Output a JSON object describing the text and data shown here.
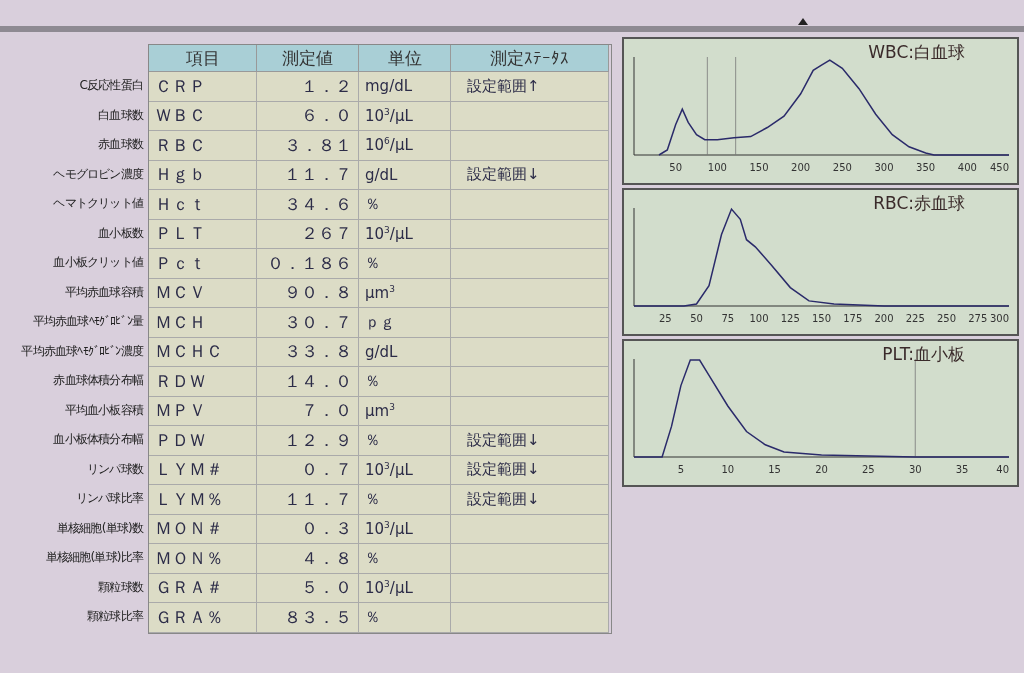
{
  "table": {
    "columns": [
      "項目",
      "測定値",
      "単位",
      "測定ｽﾃｰﾀｽ"
    ],
    "rows": [
      {
        "label": "C反応性蛋白",
        "item": "ＣＲＰ",
        "value": "１．２",
        "unit": "mg/dL",
        "status": "設定範囲↑"
      },
      {
        "label": "白血球数",
        "item": "ＷＢＣ",
        "value": "６．０",
        "unit": "10$^{3}$/μL"
      },
      {
        "label": "赤血球数",
        "item": "ＲＢＣ",
        "value": "３．８１",
        "unit": "10$^{6}$/μL"
      },
      {
        "label": "ヘモグロビン濃度",
        "item": "Ｈｇｂ",
        "value": "１１．７",
        "unit": "g/dL",
        "status": "設定範囲↓"
      },
      {
        "label": "ヘマトクリット値",
        "item": "Ｈｃｔ",
        "value": "３４．６",
        "unit": "％"
      },
      {
        "label": "血小板数",
        "item": "ＰＬＴ",
        "value": "２６７",
        "unit": "10$^{3}$/μL"
      },
      {
        "label": "血小板クリット値",
        "item": "Ｐｃｔ",
        "value": "０．１８６",
        "unit": "％"
      },
      {
        "label": "平均赤血球容積",
        "item": "ＭＣＶ",
        "value": "９０．８",
        "unit": "μm$^{3}$"
      },
      {
        "label": "平均赤血球ﾍﾓｸﾞﾛﾋﾞﾝ量",
        "item": "ＭＣＨ",
        "value": "３０．７",
        "unit": "ｐｇ"
      },
      {
        "label": "平均赤血球ﾍﾓｸﾞﾛﾋﾞﾝ濃度",
        "item": "ＭＣＨＣ",
        "value": "３３．８",
        "unit": "g/dL"
      },
      {
        "label": "赤血球体積分布幅",
        "item": "ＲＤＷ",
        "value": "１４．０",
        "unit": "％"
      },
      {
        "label": "平均血小板容積",
        "item": "ＭＰＶ",
        "value": "７．０",
        "unit": "μm$^{3}$"
      },
      {
        "label": "血小板体積分布幅",
        "item": "ＰＤＷ",
        "value": "１２．９",
        "unit": "％",
        "status": "設定範囲↓"
      },
      {
        "label": "リンパ球数",
        "item": "ＬＹＭ＃",
        "value": "０．７",
        "unit": "10$^{3}$/μL",
        "status": "設定範囲↓"
      },
      {
        "label": "リンパ球比率",
        "item": "ＬＹＭ％",
        "value": "１１．７",
        "unit": "％",
        "status": "設定範囲↓"
      },
      {
        "label": "単核細胞(単球)数",
        "item": "ＭＯＮ＃",
        "value": "０．３",
        "unit": "10$^{3}$/μL"
      },
      {
        "label": "単核細胞(単球)比率",
        "item": "ＭＯＮ％",
        "value": "４．８",
        "unit": "％"
      },
      {
        "label": "顆粒球数",
        "item": "ＧＲＡ＃",
        "value": "５．０",
        "unit": "10$^{3}$/μL"
      },
      {
        "label": "顆粒球比率",
        "item": "ＧＲＡ％",
        "value": "８３．５",
        "unit": "％"
      }
    ]
  },
  "histograms": [
    {
      "title": "WBC:白血球",
      "ticks": [
        "50",
        "100",
        "150",
        "200",
        "250",
        "300",
        "350",
        "400",
        "450"
      ]
    },
    {
      "title": "RBC:赤血球",
      "ticks": [
        "25",
        "50",
        "75",
        "100",
        "125",
        "150",
        "175",
        "200",
        "225",
        "250",
        "275",
        "300"
      ]
    },
    {
      "title": "PLT:血小板",
      "ticks": [
        "5",
        "10",
        "15",
        "20",
        "25",
        "30",
        "35",
        "40"
      ]
    }
  ]
}
